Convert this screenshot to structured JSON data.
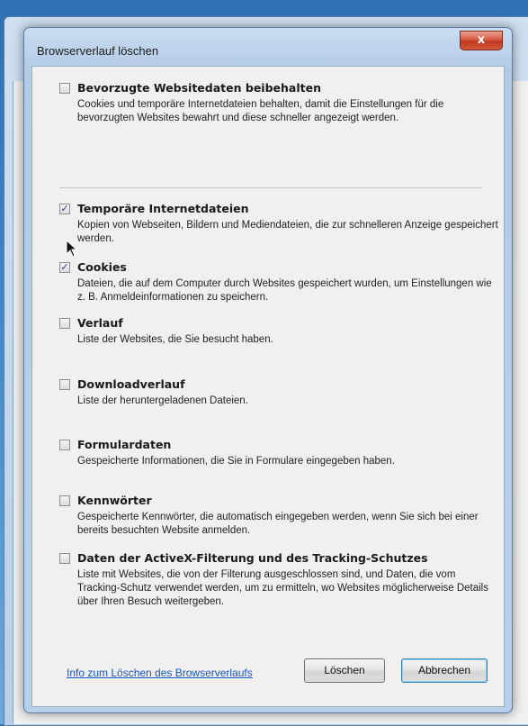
{
  "dialog": {
    "title": "Browserverlauf löschen",
    "close_label": "x"
  },
  "options": [
    {
      "title": "Bevorzugte Websitedaten beibehalten",
      "description": "Cookies und temporäre Internetdateien behalten, damit die Einstellungen für die bevorzugten Websites bewahrt und diese schneller angezeigt werden.",
      "checked": false
    },
    {
      "title": "Temporäre Internetdateien",
      "description": "Kopien von Webseiten, Bildern und Mediendateien, die zur schnelleren Anzeige gespeichert werden.",
      "checked": true
    },
    {
      "title": "Cookies",
      "description": "Dateien, die auf dem Computer durch Websites gespeichert wurden, um Einstellungen wie z. B. Anmeldeinformationen zu speichern.",
      "checked": true
    },
    {
      "title": "Verlauf",
      "description": "Liste der Websites, die Sie besucht haben.",
      "checked": false
    },
    {
      "title": "Downloadverlauf",
      "description": "Liste der heruntergeladenen Dateien.",
      "checked": false
    },
    {
      "title": "Formulardaten",
      "description": "Gespeicherte Informationen, die Sie in Formulare eingegeben haben.",
      "checked": false
    },
    {
      "title": "Kennwörter",
      "description": "Gespeicherte Kennwörter, die automatisch eingegeben werden, wenn Sie sich bei einer bereits besuchten Website anmelden.",
      "checked": false
    },
    {
      "title": "Daten der ActiveX-Filterung und des Tracking-Schutzes",
      "description": "Liste mit Websites, die von der Filterung ausgeschlossen sind, und Daten, die vom Tracking-Schutz verwendet werden, um zu ermitteln, wo Websites möglicherweise Details über Ihren Besuch weitergeben.",
      "checked": false
    }
  ],
  "footer": {
    "info_link": "Info zum Löschen des Browserverlaufs",
    "delete_button": "Löschen",
    "cancel_button": "Abbrechen"
  },
  "colors": {
    "link": "#1b55c7",
    "checkmark": "#1b4aa8",
    "close_button": "#c0391f"
  }
}
